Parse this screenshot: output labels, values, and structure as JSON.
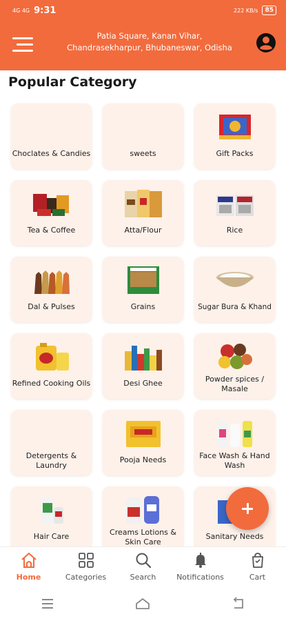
{
  "status_bar": {
    "left_icons": "4G 4G",
    "time": "9:31",
    "right_text": "222 KB/s",
    "battery": "85"
  },
  "header": {
    "address_line1": "Patia Square, Kanan Vihar,",
    "address_line2": "Chandrasekharpur, Bhubaneswar, Odisha"
  },
  "section_title": "Popular Category",
  "categories": [
    {
      "label": "Choclates & Candies"
    },
    {
      "label": "sweets"
    },
    {
      "label": "Gift Packs"
    },
    {
      "label": "Tea & Coffee"
    },
    {
      "label": "Atta/Flour"
    },
    {
      "label": "Rice"
    },
    {
      "label": "Dal & Pulses"
    },
    {
      "label": "Grains"
    },
    {
      "label": "Sugar Bura & Khand"
    },
    {
      "label": "Refined Cooking Oils"
    },
    {
      "label": "Desi Ghee"
    },
    {
      "label": "Powder spices / Masale"
    },
    {
      "label": "Detergents & Laundry"
    },
    {
      "label": "Pooja Needs"
    },
    {
      "label": "Face Wash & Hand Wash"
    },
    {
      "label": "Hair Care"
    },
    {
      "label": "Creams Lotions & Skin Care"
    },
    {
      "label": "Sanitary Needs"
    }
  ],
  "bottom_nav": [
    {
      "label": "Home",
      "icon": "home-icon",
      "active": true
    },
    {
      "label": "Categories",
      "icon": "grid-icon"
    },
    {
      "label": "Search",
      "icon": "search-icon"
    },
    {
      "label": "Notifications",
      "icon": "bell-icon"
    },
    {
      "label": "Cart",
      "icon": "cart-icon"
    }
  ],
  "colors": {
    "accent": "#f26b3d",
    "card_bg": "#fdf1ea"
  }
}
